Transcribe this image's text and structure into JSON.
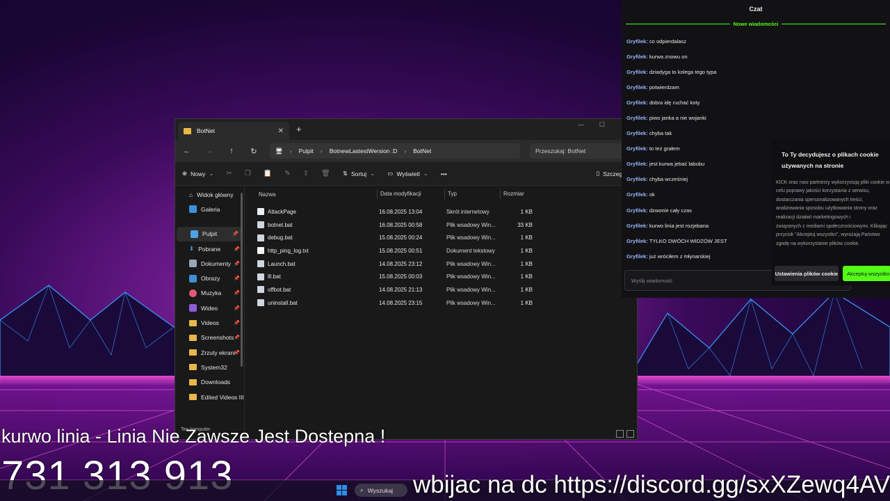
{
  "explorer": {
    "tab_title": "BotNet",
    "close_glyph": "✕",
    "new_tab_glyph": "+",
    "breadcrumb": [
      "Pulpit",
      "BotnewLastestWersion :D",
      "BotNet"
    ],
    "search_placeholder": "Przeszukaj: BotNet",
    "toolbar": {
      "new_label": "Nowy",
      "sort_label": "Sortuj",
      "view_label": "Wyświetl",
      "more_label": "•••",
      "details_label": "Szczegóły"
    },
    "sidebar": {
      "top": [
        {
          "label": "Widok główny"
        },
        {
          "label": "Galeria"
        }
      ],
      "pinned": [
        {
          "label": "Pulpit"
        },
        {
          "label": "Pobrane"
        },
        {
          "label": "Dokumenty"
        },
        {
          "label": "Obrazy"
        },
        {
          "label": "Muzyka"
        },
        {
          "label": "Wideo"
        },
        {
          "label": "Videos"
        },
        {
          "label": "Screenshots"
        },
        {
          "label": "Zrzuty ekrani"
        },
        {
          "label": "System32"
        },
        {
          "label": "Downloads"
        },
        {
          "label": "Edited Videos III"
        }
      ],
      "bottom_partial": "Ten komputer"
    },
    "columns": [
      "Nazwa",
      "Data modyfikacji",
      "Typ",
      "Rozmiar"
    ],
    "files": [
      {
        "name": "AttackPage",
        "date": "16.08.2025 13:04",
        "type": "Skrót internetowy",
        "size": "1 KB"
      },
      {
        "name": "botnet.bat",
        "date": "16.08.2025 00:58",
        "type": "Plik wsadowy Win...",
        "size": "33 KB"
      },
      {
        "name": "debug.bat",
        "date": "15.08.2025 00:24",
        "type": "Plik wsadowy Win...",
        "size": "1 KB"
      },
      {
        "name": "http_ping_log.txt",
        "date": "15.08.2025 00:51",
        "type": "Dokument tekstowy",
        "size": "1 KB"
      },
      {
        "name": "Launch.bat",
        "date": "14.08.2025 23:12",
        "type": "Plik wsadowy Win...",
        "size": "1 KB"
      },
      {
        "name": "lll.bat",
        "date": "15.08.2025 00:03",
        "type": "Plik wsadowy Win...",
        "size": "1 KB"
      },
      {
        "name": "offbot.bat",
        "date": "14.08.2025 21:13",
        "type": "Plik wsadowy Win...",
        "size": "1 KB"
      },
      {
        "name": "uninstall.bat",
        "date": "14.08.2025 23:15",
        "type": "Plik wsadowy Win...",
        "size": "1 KB"
      }
    ]
  },
  "chat": {
    "header": "Czat",
    "new_messages": "Nowe wiadomości",
    "messages": [
      {
        "user": "Gryfilek:",
        "text": "co odpierdalasz"
      },
      {
        "user": "Gryfilek:",
        "text": "kurwa znowu on"
      },
      {
        "user": "Gryfilek:",
        "text": "dziadyga to kolega tego typa"
      },
      {
        "user": "Gryfilek:",
        "text": "potwierdzam"
      },
      {
        "user": "Gryfilek:",
        "text": "dobra idę ruchać koty"
      },
      {
        "user": "Gryfilek:",
        "text": "piwo janka a nie wojanki"
      },
      {
        "user": "Gryfilek:",
        "text": "chyba tak"
      },
      {
        "user": "Gryfilek:",
        "text": "to też grałem"
      },
      {
        "user": "Gryfilek:",
        "text": "jest kurwa jebać labubu"
      },
      {
        "user": "Gryfilek:",
        "text": "chyba wcześniej"
      },
      {
        "user": "Gryfilek:",
        "text": "ok"
      },
      {
        "user": "Gryfilek:",
        "text": "dzwonie cały czas"
      },
      {
        "user": "Gryfilek:",
        "text": "kurwo linia jest rozjebana"
      },
      {
        "user": "Gryfilek:",
        "text": "TYLKO DWÓCH WIDZÓW JEST"
      },
      {
        "user": "Gryfilek:",
        "text": "już wróciłem z młynarskiej"
      }
    ],
    "input_placeholder": "Wyślij wiadomość"
  },
  "cookie": {
    "title_line1": "To Ty decydujesz o plikach cookie",
    "title_line2": "używanych na stronie",
    "body": [
      "KICK oraz nasi partnerzy wykorzystują pliki cookie w",
      "celu poprawy jakości korzystania z serwisu,",
      "dostarczania spersonalizowanych treści,",
      "analizowania sposobu użytkowania strony oraz",
      "realizacji działań marketingowych i",
      "związanych z mediami społecznościowymi. Klikając",
      "przycisk \"Akceptuj wszystko\", wyrażają Państwo",
      "zgodę na wykorzystanie plików cookie."
    ],
    "settings_label": "Ustawienia plików cookie",
    "accept_label": "Akceptuj wszystko"
  },
  "overlays": {
    "line1": "kurwo linia  - Linia Nie Zawsze Jest Dostepna !",
    "phone": "731 313 913",
    "discord": "wbijac na dc https://discord.gg/sxXZewq4AV"
  },
  "taskbar": {
    "search_label": "Wyszukaj"
  },
  "colors": {
    "kick_green": "#53fc18",
    "username": "#9bb4ff",
    "folder": "#e8b84a"
  }
}
